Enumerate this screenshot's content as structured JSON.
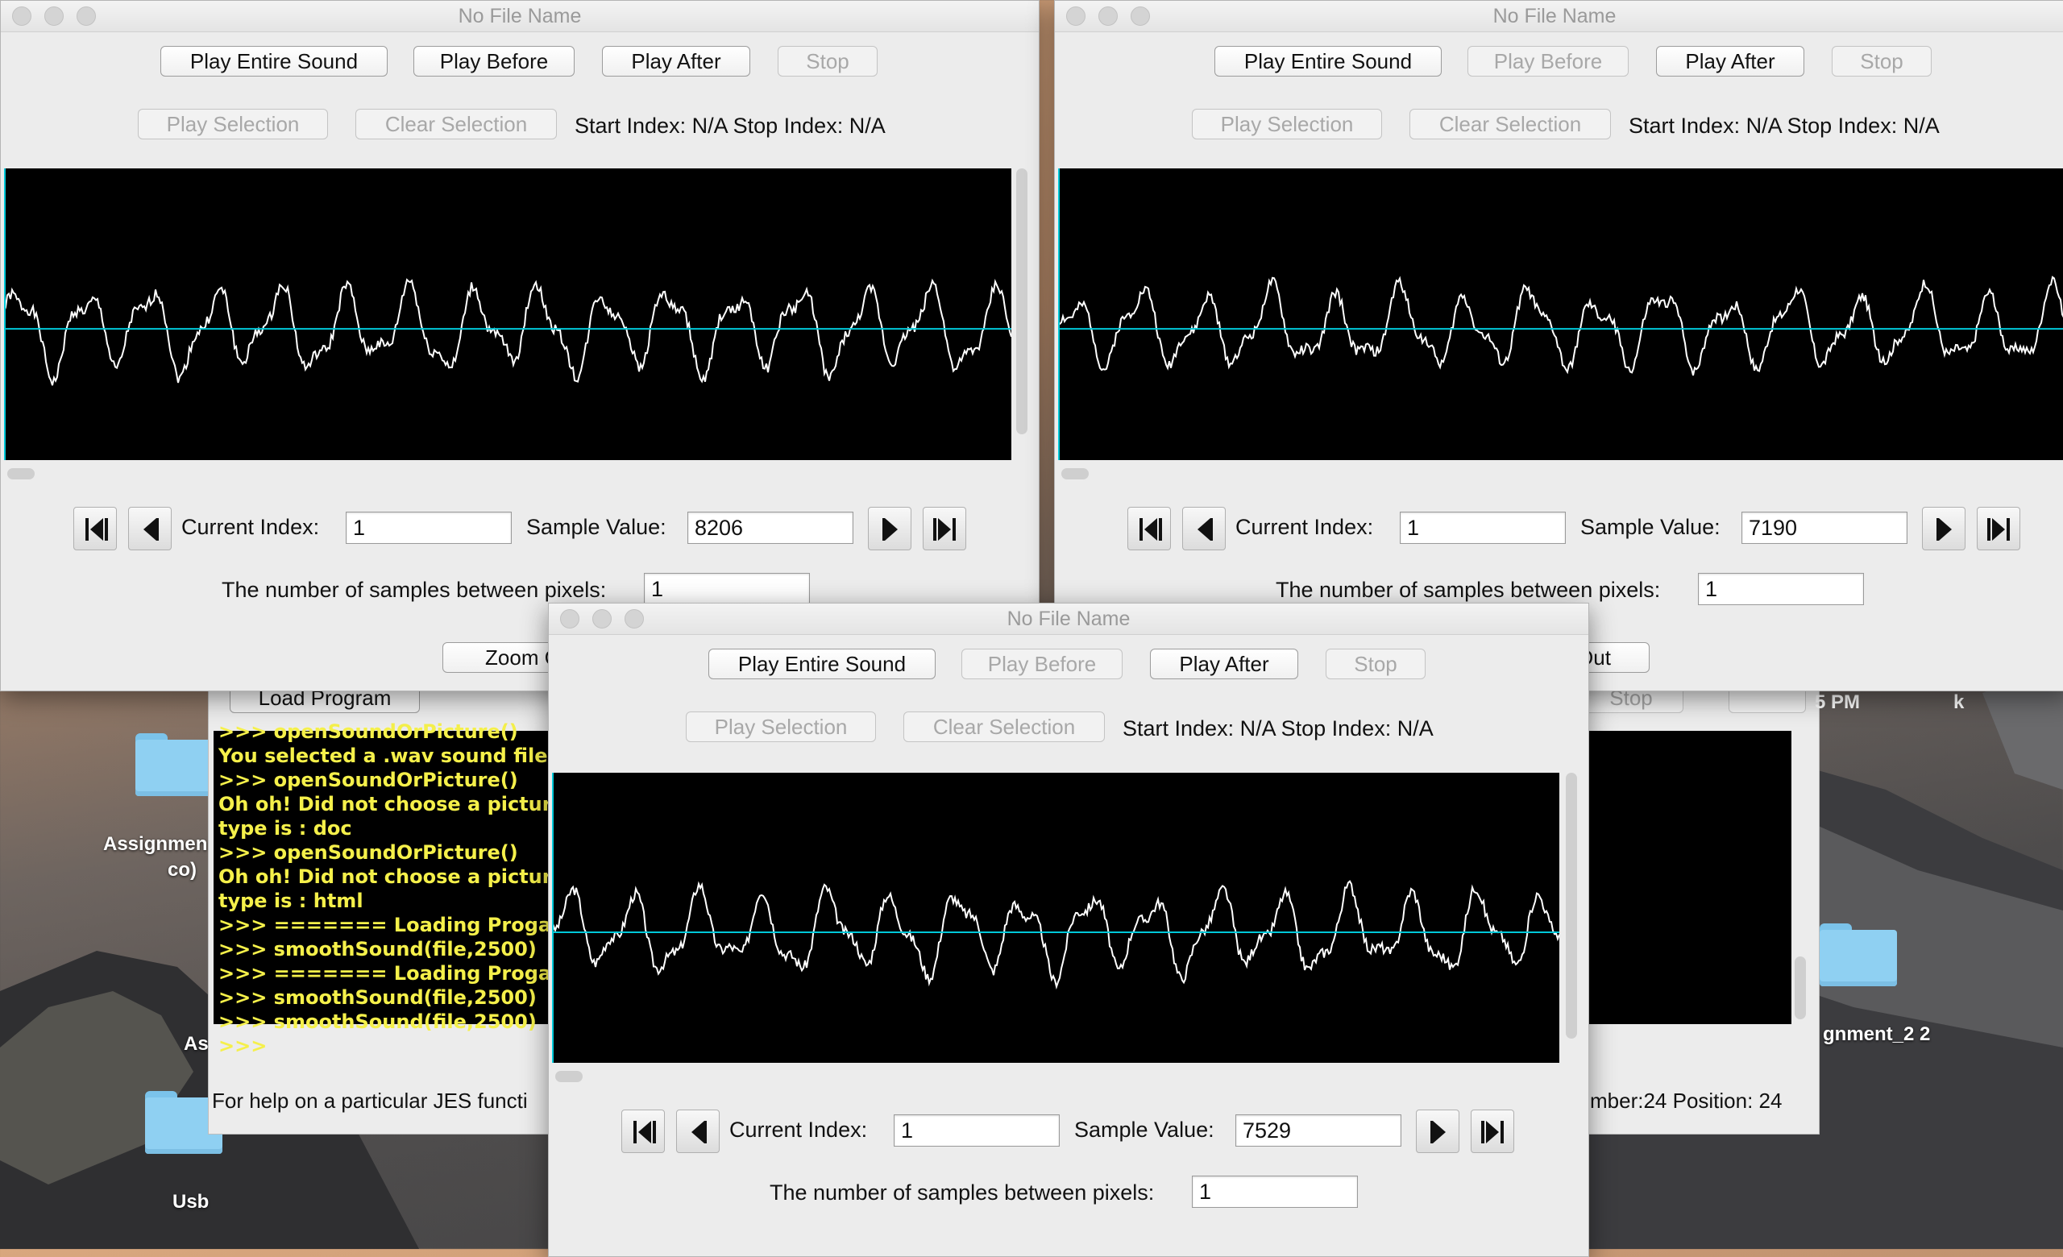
{
  "desktop": {
    "icons": [
      {
        "label": "Assignmen"
      },
      {
        "label": "co)"
      },
      {
        "label": "As"
      },
      {
        "label": "Usb"
      },
      {
        "label": "gnment_2 2"
      }
    ]
  },
  "jes": {
    "load_button": "Load Program",
    "stop_button": "Stop",
    "clock_fragment": "5 PM",
    "k_fragment": "k",
    "console_lines": [
      ">>> openSoundOrPicture()",
      "You selected a .wav sound file",
      ">>> openSoundOrPicture()",
      "Oh oh! Did not choose a picture or s",
      "type is : doc",
      ">>> openSoundOrPicture()",
      "Oh oh! Did not choose a picture or s",
      "type is : html",
      ">>>  ======= Loading Progam",
      ">>> smoothSound(file,2500)",
      ">>>  ======= Loading Progam",
      ">>> smoothSound(file,2500)",
      ">>> smoothSound(file,2500)",
      ">>> "
    ],
    "help_text": "For help on a particular JES functi",
    "status_text": "mber:24 Position: 24"
  },
  "windows": [
    {
      "title": "No File Name",
      "play_entire": "Play Entire Sound",
      "play_before": "Play Before",
      "play_after": "Play After",
      "stop": "Stop",
      "play_selection": "Play Selection",
      "clear_selection": "Clear Selection",
      "index_info": "Start Index: N/A Stop Index: N/A",
      "current_index_label": "Current Index:",
      "current_index": "1",
      "sample_value_label": "Sample Value:",
      "sample_value": "8206",
      "samples_label": "The number of samples between pixels:",
      "samples_value": "1",
      "zoom_label": "Zoom O",
      "colors": {
        "wave": "#ffffff",
        "axis": "#00c8d8"
      }
    },
    {
      "title": "No File Name",
      "play_entire": "Play Entire Sound",
      "play_before": "Play Before",
      "play_after": "Play After",
      "stop": "Stop",
      "play_selection": "Play Selection",
      "clear_selection": "Clear Selection",
      "index_info": "Start Index: N/A Stop Index: N/A",
      "current_index_label": "Current Index:",
      "current_index": "1",
      "sample_value_label": "Sample Value:",
      "sample_value": "7190",
      "samples_label": "The number of samples between pixels:",
      "samples_value": "1",
      "zoom_label": "Out"
    },
    {
      "title": "No File Name",
      "play_entire": "Play Entire Sound",
      "play_before": "Play Before",
      "play_after": "Play After",
      "stop": "Stop",
      "play_selection": "Play Selection",
      "clear_selection": "Clear Selection",
      "index_info": "Start Index: N/A Stop Index: N/A",
      "current_index_label": "Current Index:",
      "current_index": "1",
      "sample_value_label": "Sample Value:",
      "sample_value": "7529",
      "samples_label": "The number of samples between pixels:",
      "samples_value": "1"
    }
  ]
}
